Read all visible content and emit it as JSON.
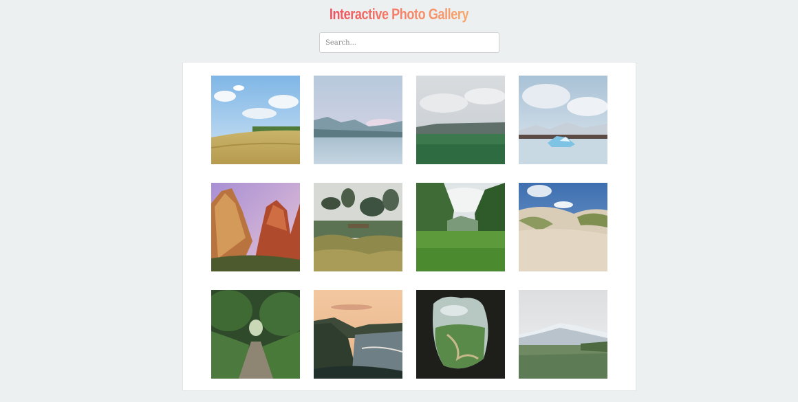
{
  "header": {
    "title": "Interactive Photo Gallery"
  },
  "search": {
    "placeholder": "Search...",
    "value": ""
  },
  "gallery": {
    "photos": [
      {
        "subject": "wheat-field-landscape"
      },
      {
        "subject": "lake-mountains-landscape"
      },
      {
        "subject": "green-meadow-cloudy-landscape"
      },
      {
        "subject": "glacier-lagoon-landscape"
      },
      {
        "subject": "red-rock-canyon-landscape"
      },
      {
        "subject": "garden-trees-landscape"
      },
      {
        "subject": "green-valley-landscape"
      },
      {
        "subject": "sand-dunes-landscape"
      },
      {
        "subject": "forest-path-landscape"
      },
      {
        "subject": "coastline-sunset-landscape"
      },
      {
        "subject": "cave-view-landscape"
      },
      {
        "subject": "snowy-mountain-field-landscape"
      }
    ]
  }
}
